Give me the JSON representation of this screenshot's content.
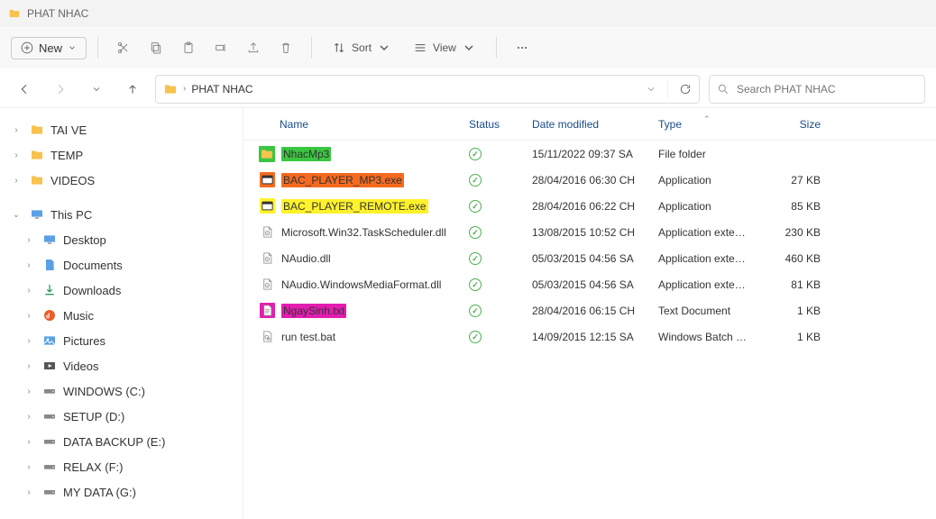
{
  "title": "PHAT NHAC",
  "toolbar": {
    "new_label": "New",
    "sort_label": "Sort",
    "view_label": "View"
  },
  "addressbar": {
    "crumb": "PHAT NHAC"
  },
  "search": {
    "placeholder": "Search PHAT NHAC"
  },
  "sidebar": {
    "quick": [
      {
        "label": "TAI VE"
      },
      {
        "label": "TEMP"
      },
      {
        "label": "VIDEOS"
      }
    ],
    "thispc_label": "This PC",
    "locations": [
      {
        "label": "Desktop",
        "icon": "desktop"
      },
      {
        "label": "Documents",
        "icon": "documents"
      },
      {
        "label": "Downloads",
        "icon": "downloads"
      },
      {
        "label": "Music",
        "icon": "music"
      },
      {
        "label": "Pictures",
        "icon": "pictures"
      },
      {
        "label": "Videos",
        "icon": "videos"
      },
      {
        "label": "WINDOWS (C:)",
        "icon": "drive"
      },
      {
        "label": "SETUP (D:)",
        "icon": "drive"
      },
      {
        "label": "DATA BACKUP (E:)",
        "icon": "drive"
      },
      {
        "label": "RELAX (F:)",
        "icon": "drive"
      },
      {
        "label": "MY DATA (G:)",
        "icon": "drive"
      }
    ]
  },
  "columns": {
    "name": "Name",
    "status": "Status",
    "date": "Date modified",
    "type": "Type",
    "size": "Size"
  },
  "files": [
    {
      "name": "NhacMp3",
      "icon": "folder",
      "highlight": "green",
      "date": "15/11/2022 09:37 SA",
      "type": "File folder",
      "size": ""
    },
    {
      "name": "BAC_PLAYER_MP3.exe",
      "icon": "exe",
      "highlight": "orange",
      "date": "28/04/2016 06:30 CH",
      "type": "Application",
      "size": "27 KB"
    },
    {
      "name": "BAC_PLAYER_REMOTE.exe",
      "icon": "exe",
      "highlight": "yellow",
      "date": "28/04/2016 06:22 CH",
      "type": "Application",
      "size": "85 KB"
    },
    {
      "name": "Microsoft.Win32.TaskScheduler.dll",
      "icon": "dll",
      "highlight": "",
      "date": "13/08/2015 10:52 CH",
      "type": "Application exten...",
      "size": "230 KB"
    },
    {
      "name": "NAudio.dll",
      "icon": "dll",
      "highlight": "",
      "date": "05/03/2015 04:56 SA",
      "type": "Application exten...",
      "size": "460 KB"
    },
    {
      "name": "NAudio.WindowsMediaFormat.dll",
      "icon": "dll",
      "highlight": "",
      "date": "05/03/2015 04:56 SA",
      "type": "Application exten...",
      "size": "81 KB"
    },
    {
      "name": "NgaySinh.txt",
      "icon": "txt",
      "highlight": "pink",
      "date": "28/04/2016 06:15 CH",
      "type": "Text Document",
      "size": "1 KB"
    },
    {
      "name": "run test.bat",
      "icon": "bat",
      "highlight": "",
      "date": "14/09/2015 12:15 SA",
      "type": "Windows Batch File",
      "size": "1 KB"
    }
  ]
}
